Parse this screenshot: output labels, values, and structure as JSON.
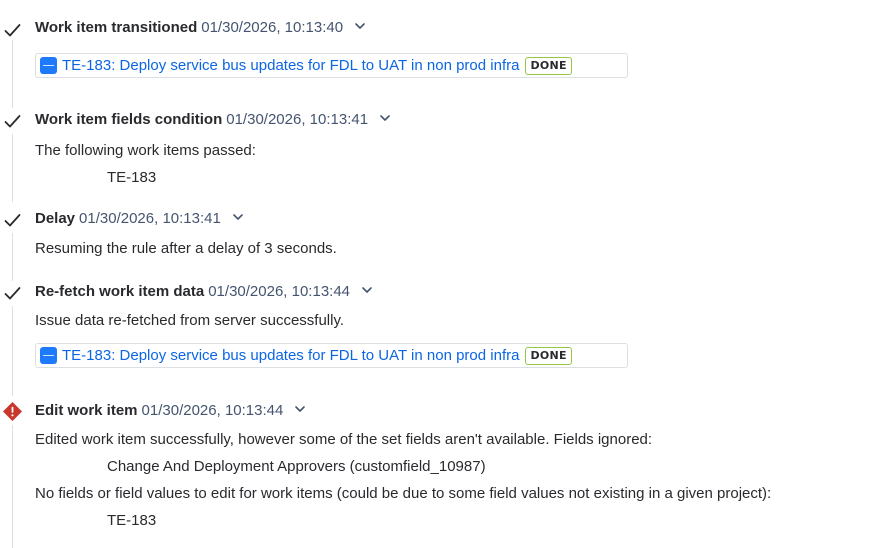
{
  "colors": {
    "text": "#292a2e",
    "timestamp": "#44546f",
    "link": "#0c66e4",
    "done_border": "#94c748",
    "error": "#c9372c",
    "tile": "#1d7afc"
  },
  "entries": [
    {
      "status": "success",
      "icon": "check-icon",
      "title": "Work item transitioned",
      "timestamp": "01/30/2026, 10:13:40",
      "link": {
        "text": "TE-183: Deploy service bus updates for FDL to UAT in non prod infra",
        "status": "DONE",
        "icon": "task-type-icon"
      }
    },
    {
      "status": "success",
      "icon": "check-icon",
      "title": "Work item fields condition",
      "timestamp": "01/30/2026, 10:13:41",
      "message": "The following work items passed:",
      "item": "TE-183"
    },
    {
      "status": "success",
      "icon": "check-icon",
      "title": "Delay",
      "timestamp": "01/30/2026, 10:13:41",
      "message": "Resuming the rule after a delay of 3 seconds."
    },
    {
      "status": "success",
      "icon": "check-icon",
      "title": "Re-fetch work item data",
      "timestamp": "01/30/2026, 10:13:44",
      "message": "Issue data re-fetched from server successfully.",
      "link": {
        "text": "TE-183: Deploy service bus updates for FDL to UAT in non prod infra",
        "status": "DONE",
        "icon": "task-type-icon"
      }
    },
    {
      "status": "error",
      "icon": "error-icon",
      "title": "Edit work item",
      "timestamp": "01/30/2026, 10:13:44",
      "message": "Edited work item successfully, however some of the set fields aren't available. Fields ignored:",
      "ignored_field": "Change And Deployment Approvers (customfield_10987)",
      "message2": "No fields or field values to edit for work items (could be due to some field values not existing in a given project):",
      "item": "TE-183"
    }
  ]
}
